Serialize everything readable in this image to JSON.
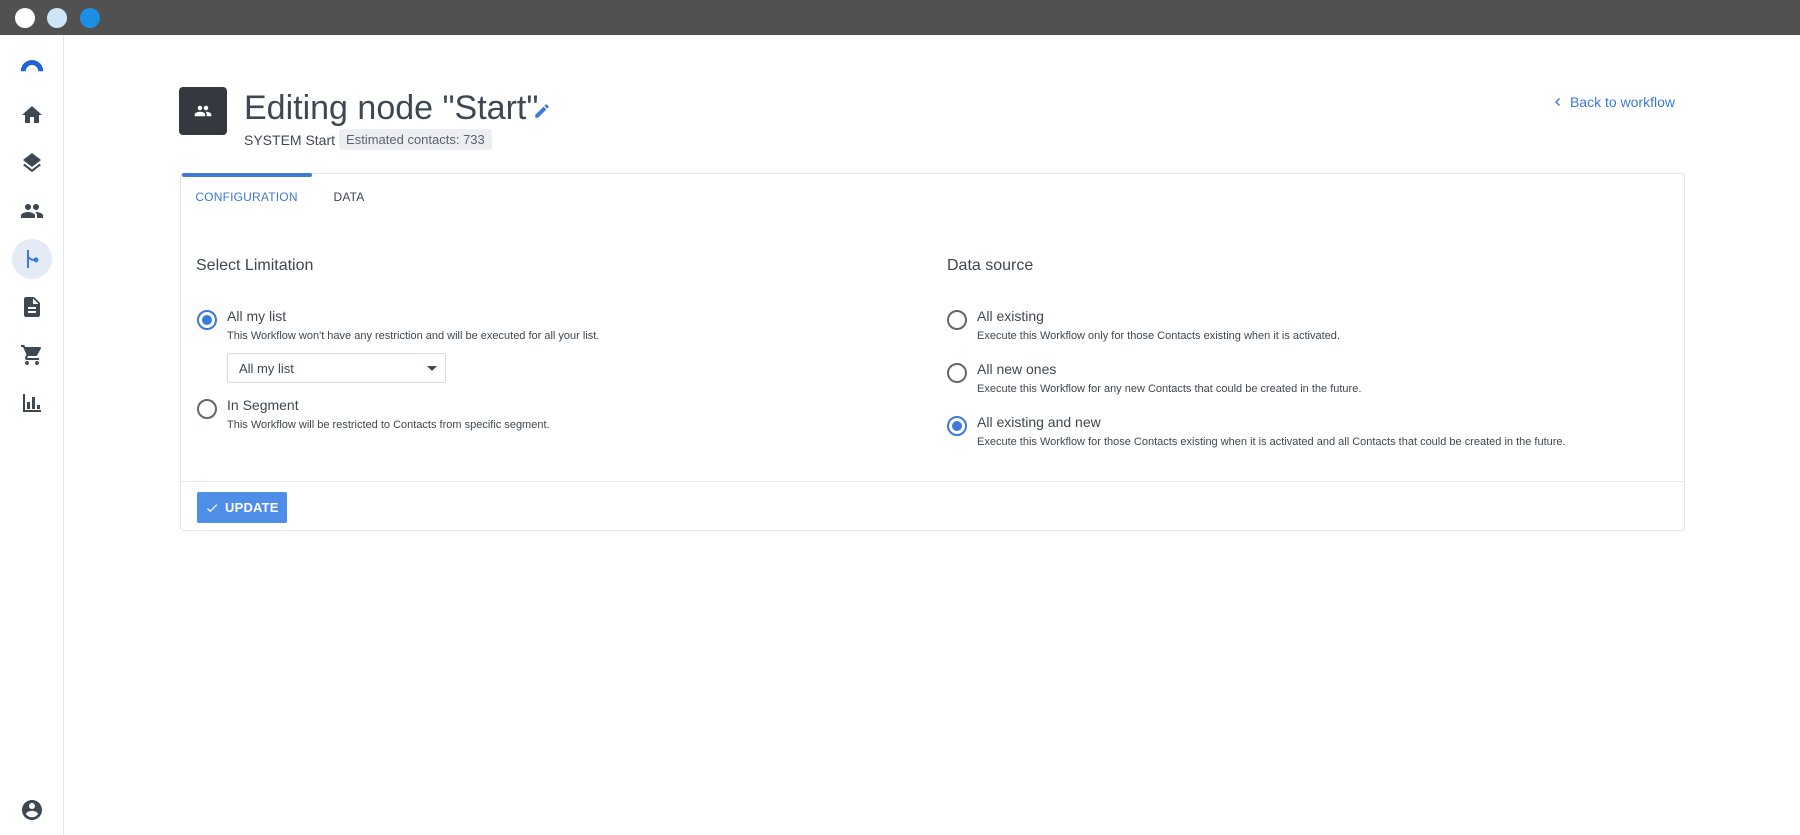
{
  "colors": {
    "accent": "#3b7ad9",
    "titlebar": "#515151",
    "dot_white": "#ffffff",
    "dot_light_blue": "#cde6f7",
    "dot_blue": "#1a8fe3"
  },
  "sidebar": {
    "items": [
      {
        "icon": "logo-icon",
        "active": false
      },
      {
        "icon": "home-icon",
        "active": false
      },
      {
        "icon": "layers-icon",
        "active": false
      },
      {
        "icon": "people-icon",
        "active": false
      },
      {
        "icon": "workflow-icon",
        "active": true
      },
      {
        "icon": "document-icon",
        "active": false
      },
      {
        "icon": "cart-icon",
        "active": false
      },
      {
        "icon": "bar-chart-icon",
        "active": false
      },
      {
        "icon": "account-icon",
        "active": false
      }
    ]
  },
  "header": {
    "title": "Editing node \"Start\"",
    "system_label": "SYSTEM Start",
    "estimated_contacts": "Estimated contacts: 733",
    "back_link": "Back to workflow"
  },
  "tabs": [
    {
      "label": "CONFIGURATION",
      "active": true
    },
    {
      "label": "DATA",
      "active": false
    }
  ],
  "limitation": {
    "title": "Select Limitation",
    "options": [
      {
        "label": "All my list",
        "description": "This Workflow won't have any restriction and will be executed for all your list.",
        "checked": true
      },
      {
        "label": "In Segment",
        "description": "This Workflow will be restricted to Contacts from specific segment.",
        "checked": false
      }
    ],
    "select_value": "All my list"
  },
  "data_source": {
    "title": "Data source",
    "options": [
      {
        "label": "All existing",
        "description": "Execute this Workflow only for those Contacts existing when it is activated.",
        "checked": false
      },
      {
        "label": "All new ones",
        "description": "Execute this Workflow for any new Contacts that could be created in the future.",
        "checked": false
      },
      {
        "label": "All existing and new",
        "description": "Execute this Workflow for those Contacts existing when it is activated and all Contacts that could be created in the future.",
        "checked": true
      }
    ]
  },
  "footer": {
    "update_label": "UPDATE"
  }
}
